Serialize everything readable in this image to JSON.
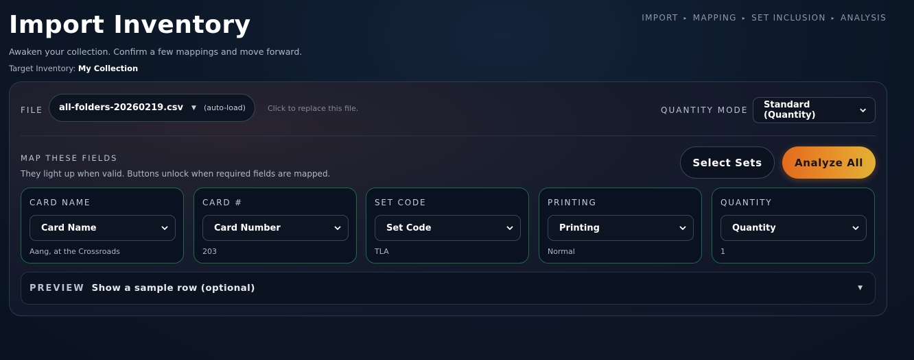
{
  "header": {
    "title": "Import Inventory",
    "subtitle": "Awaken your collection. Confirm a few mappings and move forward.",
    "target_label": "Target Inventory:",
    "target_value": "My Collection"
  },
  "steps": [
    "IMPORT",
    "MAPPING",
    "SET INCLUSION",
    "ANALYSIS"
  ],
  "file": {
    "label": "FILE",
    "name": "all-folders-20260219.csv",
    "auto": "(auto-load)",
    "hint": "Click to replace this file."
  },
  "quantity_mode": {
    "label": "QUANTITY MODE",
    "selected": "Standard (Quantity)"
  },
  "mapping": {
    "label": "MAP THESE FIELDS",
    "hint": "They light up when valid. Buttons unlock when required fields are mapped.",
    "fields": [
      {
        "label": "CARD NAME",
        "selected": "Card Name",
        "sample": "Aang, at the Crossroads"
      },
      {
        "label": "CARD #",
        "selected": "Card Number",
        "sample": "203"
      },
      {
        "label": "SET CODE",
        "selected": "Set Code",
        "sample": "TLA"
      },
      {
        "label": "PRINTING",
        "selected": "Printing",
        "sample": "Normal"
      },
      {
        "label": "QUANTITY",
        "selected": "Quantity",
        "sample": "1"
      }
    ]
  },
  "buttons": {
    "select_sets": "Select Sets",
    "analyze_all": "Analyze All"
  },
  "preview": {
    "label": "PREVIEW",
    "text": "Show a sample row (optional)"
  },
  "colors": {
    "accent_start": "#e36a1d",
    "accent_end": "#e2b236",
    "valid_border": "#1f6b47"
  }
}
